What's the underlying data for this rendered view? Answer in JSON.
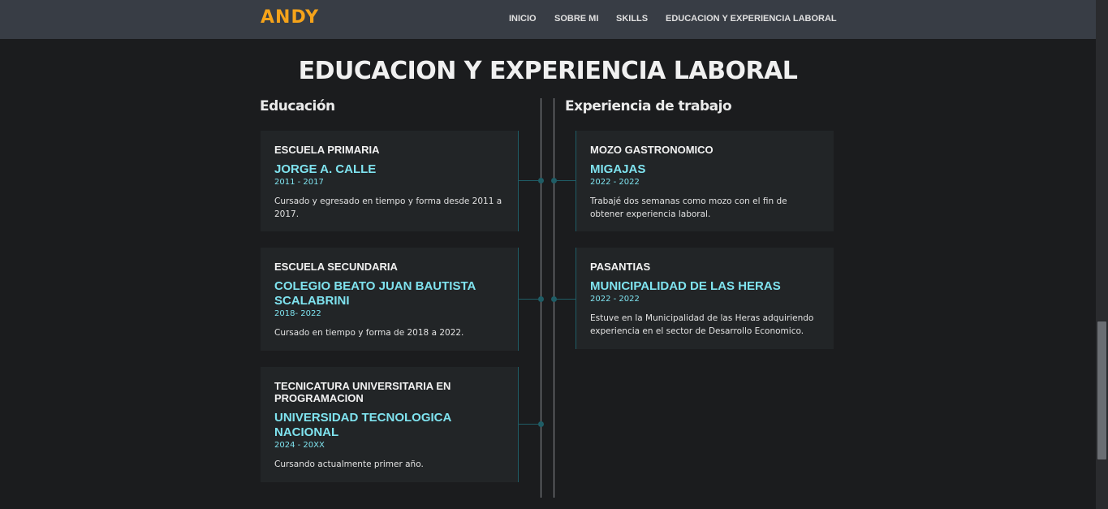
{
  "header": {
    "logo": "ANDY",
    "nav": [
      "INICIO",
      "SOBRE MI",
      "SKILLS",
      "EDUCACION Y EXPERIENCIA LABORAL"
    ]
  },
  "section": {
    "title": "EDUCACION Y EXPERIENCIA LABORAL",
    "education_title": "Educación",
    "work_title": "Experiencia de trabajo"
  },
  "education": [
    {
      "title": "ESCUELA PRIMARIA",
      "org": "JORGE A. CALLE",
      "years": "2011 - 2017",
      "desc": "Cursado y egresado en tiempo y forma desde 2011 a 2017."
    },
    {
      "title": "ESCUELA SECUNDARIA",
      "org": "COLEGIO BEATO JUAN BAUTISTA SCALABRINI",
      "years": "2018- 2022",
      "desc": "Cursado en tiempo y forma de 2018 a 2022."
    },
    {
      "title": "TECNICATURA UNIVERSITARIA EN PROGRAMACION",
      "org": "UNIVERSIDAD TECNOLOGICA NACIONAL",
      "years": "2024 - 20XX",
      "desc": "Cursando actualmente primer año."
    }
  ],
  "work": [
    {
      "title": "MOZO GASTRONOMICO",
      "org": "MIGAJAS",
      "years": "2022 - 2022",
      "desc": "Trabajé dos semanas como mozo con el fin de obtener experiencia laboral."
    },
    {
      "title": "PASANTIAS",
      "org": "MUNICIPALIDAD DE LAS HERAS",
      "years": "2022 - 2022",
      "desc": "Estuve en la Municipalidad de las Heras adquiriendo experiencia en el sector de Desarrollo Economico."
    }
  ],
  "colors": {
    "header_bg": "#383d45",
    "logo": "#f5a31a",
    "accent": "#7fe3ef",
    "card_bg": "#222527",
    "page_bg": "#1b1c1e"
  }
}
